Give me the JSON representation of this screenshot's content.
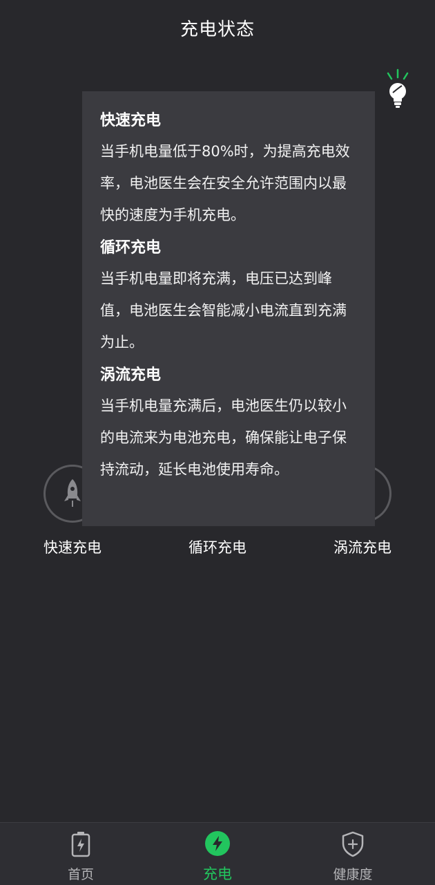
{
  "header": {
    "title": "充电状态"
  },
  "modes": [
    {
      "label": "快速充电",
      "icon": "rocket-icon"
    },
    {
      "label": "循环充电",
      "icon": "cycle-icon"
    },
    {
      "label": "涡流充电",
      "icon": "trickle-icon"
    }
  ],
  "popup": {
    "sections": [
      {
        "title": "快速充电",
        "text": "当手机电量低于80%时，为提高充电效率，电池医生会在安全允许范围内以最快的速度为手机充电。"
      },
      {
        "title": "循环充电",
        "text": "当手机电量即将充满，电压已达到峰值，电池医生会智能减小电流直到充满为止。"
      },
      {
        "title": "涡流充电",
        "text": "当手机电量充满后，电池医生仍以较小的电流来为电池充电，确保能让电子保持流动，延长电池使用寿命。"
      }
    ]
  },
  "bottom_nav": {
    "items": [
      {
        "label": "首页",
        "icon": "battery-icon"
      },
      {
        "label": "充电",
        "icon": "charge-icon",
        "active": true
      },
      {
        "label": "健康度",
        "icon": "shield-icon"
      }
    ]
  },
  "colors": {
    "background": "#28282c",
    "popup": "#3b3b40",
    "accent": "#22c55e"
  }
}
